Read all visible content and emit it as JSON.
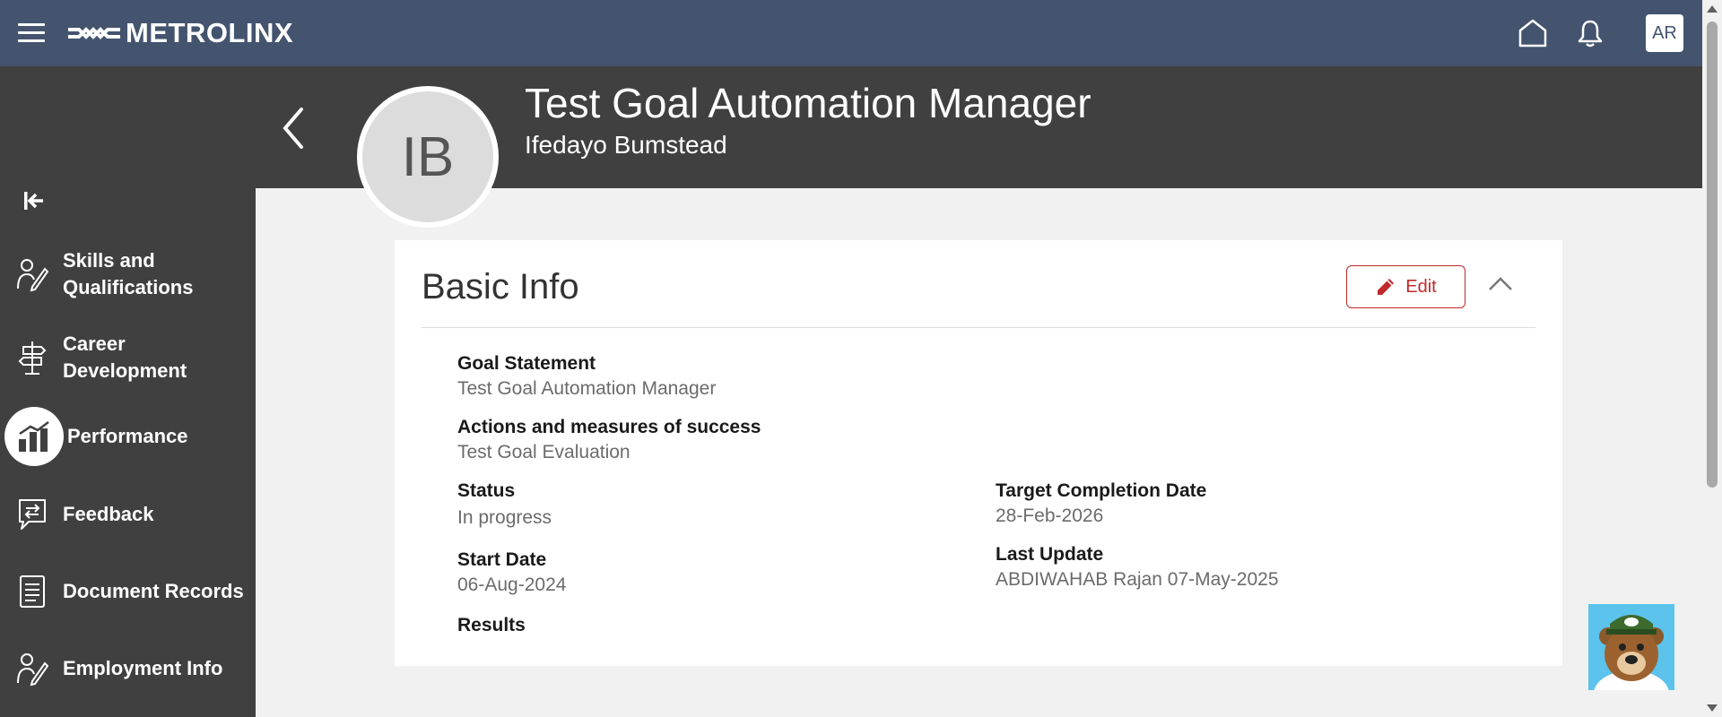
{
  "header": {
    "brand": "METROLINX",
    "user_initials": "AR",
    "icons": [
      "menu-icon",
      "home-icon",
      "bell-icon"
    ]
  },
  "sidebar": {
    "items": [
      {
        "label": "Skills and Qualifications",
        "line1": "Skills and",
        "line2": "Qualifications",
        "icon": "skills-icon"
      },
      {
        "label": "Career Development",
        "line1": "Career",
        "line2": "Development",
        "icon": "signpost-icon"
      },
      {
        "label": "Performance",
        "icon": "bar-chart-icon",
        "active": true
      },
      {
        "label": "Feedback",
        "icon": "feedback-icon"
      },
      {
        "label": "Document Records",
        "icon": "document-icon"
      },
      {
        "label": "Employment Info",
        "icon": "employment-icon"
      }
    ]
  },
  "page": {
    "title": "Test Goal Automation Manager",
    "subtitle": "Ifedayo Bumstead",
    "avatar_initials": "IB"
  },
  "card": {
    "title": "Basic Info",
    "edit_label": "Edit",
    "fields": {
      "goal_statement": {
        "label": "Goal Statement",
        "value": "Test Goal Automation Manager"
      },
      "actions": {
        "label": "Actions and measures of success",
        "value": "Test Goal Evaluation"
      },
      "status": {
        "label": "Status",
        "value": "In progress"
      },
      "target_date": {
        "label": "Target Completion Date",
        "value": "28-Feb-2026"
      },
      "start_date": {
        "label": "Start Date",
        "value": "06-Aug-2024"
      },
      "last_update": {
        "label": "Last Update",
        "value": "ABDIWAHAB Rajan 07-May-2025"
      },
      "results": {
        "label": "Results",
        "value": ""
      }
    }
  },
  "colors": {
    "topbar": "#44546f",
    "sidebar": "#404040",
    "accent_red": "#c0292b",
    "content_bg": "#f1f1f1"
  }
}
